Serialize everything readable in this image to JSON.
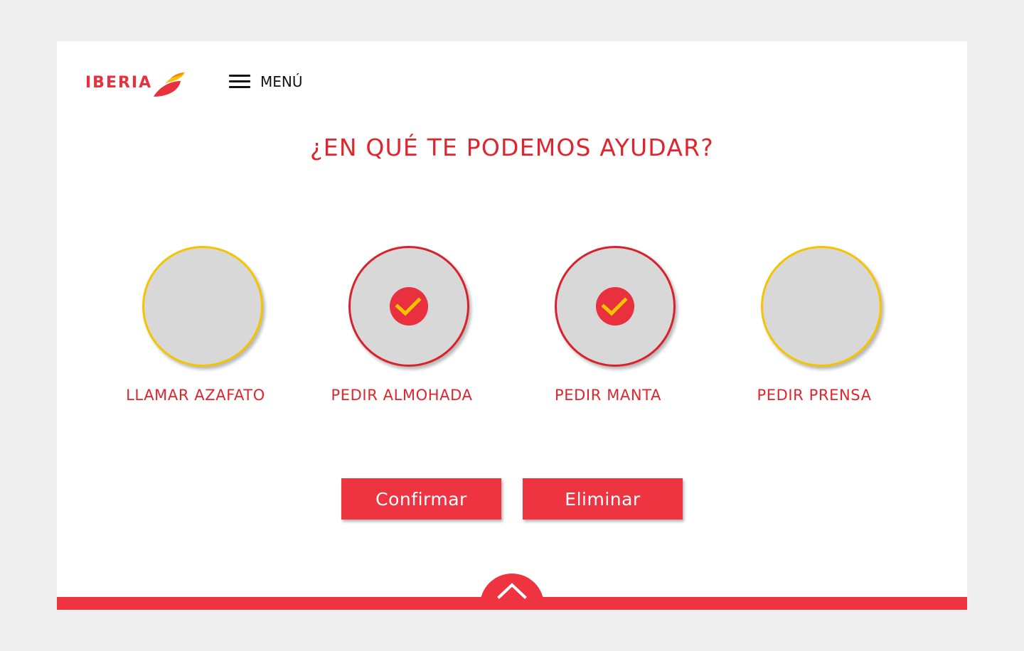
{
  "header": {
    "logo_text": "IBERIA",
    "menu_label": "MENÚ"
  },
  "main": {
    "title": "¿EN QUÉ TE PODEMOS AYUDAR?",
    "options": [
      {
        "label": "LLAMAR AZAFATO",
        "selected": false
      },
      {
        "label": "PEDIR ALMOHADA",
        "selected": true
      },
      {
        "label": "PEDIR MANTA",
        "selected": true
      },
      {
        "label": "PEDIR PRENSA",
        "selected": false
      }
    ],
    "confirm_label": "Confirmar",
    "delete_label": "Eliminar"
  },
  "icons": {
    "menu": "hamburger-icon",
    "check": "checkmark-icon",
    "scroll_up": "chevron-up-icon"
  },
  "colors": {
    "brand_red": "#ee3440",
    "title_red": "#e1252f",
    "selected_border": "#d9222c",
    "unselected_border": "#f5c400",
    "check_yellow": "#f5c400",
    "circle_fill": "#d8d8d8",
    "background": "#efefef"
  }
}
